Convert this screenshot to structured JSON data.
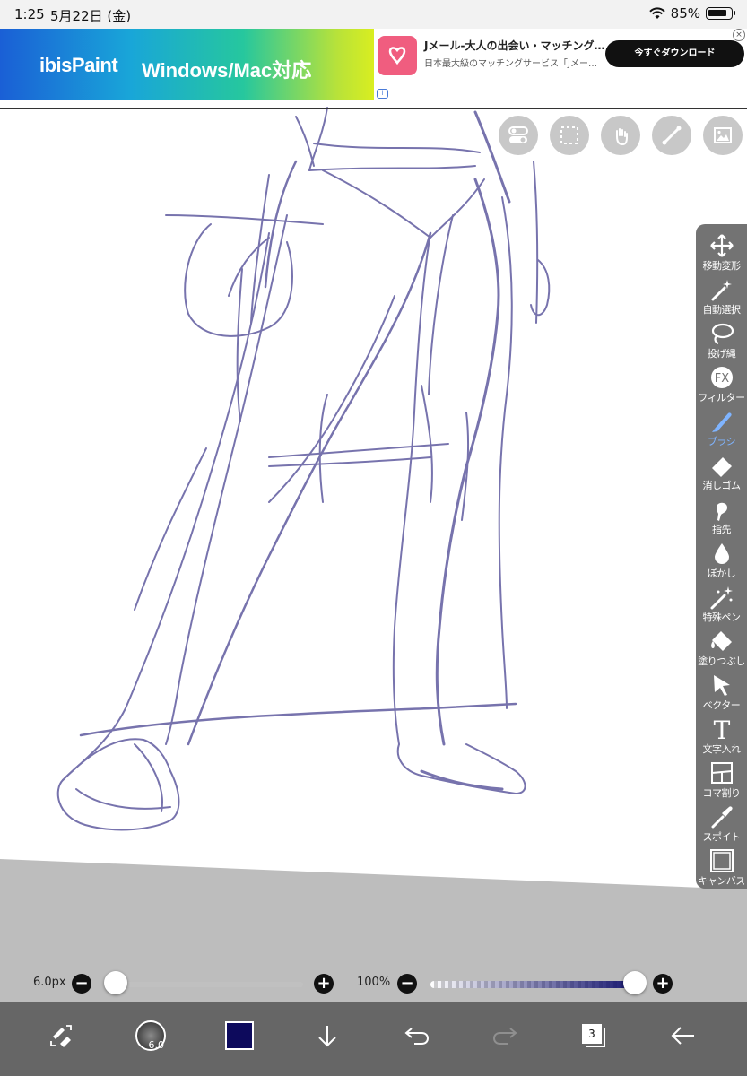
{
  "status_bar": {
    "time": "1:25",
    "date": "5月22日 (金)",
    "battery": "85%",
    "battery_level": 0.85
  },
  "ad": {
    "banner_logo": "ibisPaint",
    "banner_slogan": "Windows/Mac対応",
    "title": "Jメール-大人の出会い・マッチング…",
    "subtitle": "日本最大級のマッチングサービス「Jメー…",
    "button": "今すぐダウンロード",
    "info": "i",
    "close": "×"
  },
  "top_buttons": [
    {
      "name": "toggle-icon"
    },
    {
      "name": "selection-icon"
    },
    {
      "name": "hand-icon"
    },
    {
      "name": "ruler-icon"
    },
    {
      "name": "reference-image-icon"
    }
  ],
  "tools": [
    {
      "label": "移動変形",
      "icon": "move-icon"
    },
    {
      "label": "自動選択",
      "icon": "magic-wand-icon"
    },
    {
      "label": "投げ縄",
      "icon": "lasso-icon"
    },
    {
      "label": "フィルター",
      "icon": "fx-icon",
      "glyph": "FX"
    },
    {
      "label": "ブラシ",
      "icon": "brush-icon",
      "active": true
    },
    {
      "label": "消しゴム",
      "icon": "eraser-icon"
    },
    {
      "label": "指先",
      "icon": "finger-icon"
    },
    {
      "label": "ぼかし",
      "icon": "blur-icon"
    },
    {
      "label": "特殊ペン",
      "icon": "special-pen-icon"
    },
    {
      "label": "塗りつぶし",
      "icon": "fill-icon"
    },
    {
      "label": "ベクター",
      "icon": "vector-icon"
    },
    {
      "label": "文字入れ",
      "icon": "text-icon",
      "glyph": "T"
    },
    {
      "label": "コマ割り",
      "icon": "frame-divider-icon"
    },
    {
      "label": "スポイト",
      "icon": "eyedropper-icon"
    },
    {
      "label": "キャンバス",
      "icon": "canvas-icon"
    }
  ],
  "brush_size": {
    "label": "6.0px",
    "value": 0.03
  },
  "opacity": {
    "label": "100%",
    "value": 1.0
  },
  "bottom_bar": {
    "brush_preview_size": "6.0",
    "color": "#0d0a5c",
    "layer_count": "3"
  },
  "colors": {
    "toolbar": "#737373",
    "active_tool": "#7fb4ff",
    "stroke": "#4a4592"
  }
}
